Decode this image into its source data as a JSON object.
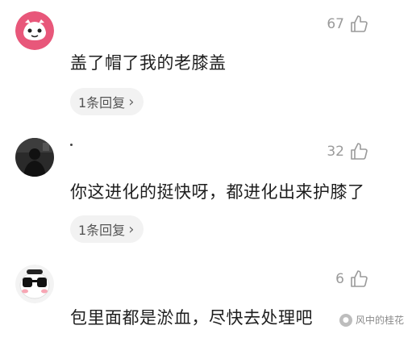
{
  "comments": [
    {
      "avatar": "cartoon-face-pink",
      "likes": "67",
      "text": "盖了帽了我的老膝盖",
      "replies_label": "1条回复",
      "replies_chevron": "›"
    },
    {
      "avatar": "dark-photo",
      "likes": "32",
      "text": "你这进化的挺快呀，都进化出来护膝了",
      "replies_label": "1条回复",
      "replies_chevron": "›"
    },
    {
      "avatar": "cartoon-sunglasses",
      "likes": "6",
      "text": "包里面都是淤血，尽快去处理吧"
    }
  ],
  "watermark": {
    "text": "风中的桂花",
    "icon": "logo-icon"
  },
  "colors": {
    "like": "#9a9a9a",
    "reply_bg": "#f2f2f2",
    "text": "#1e1e1e"
  }
}
